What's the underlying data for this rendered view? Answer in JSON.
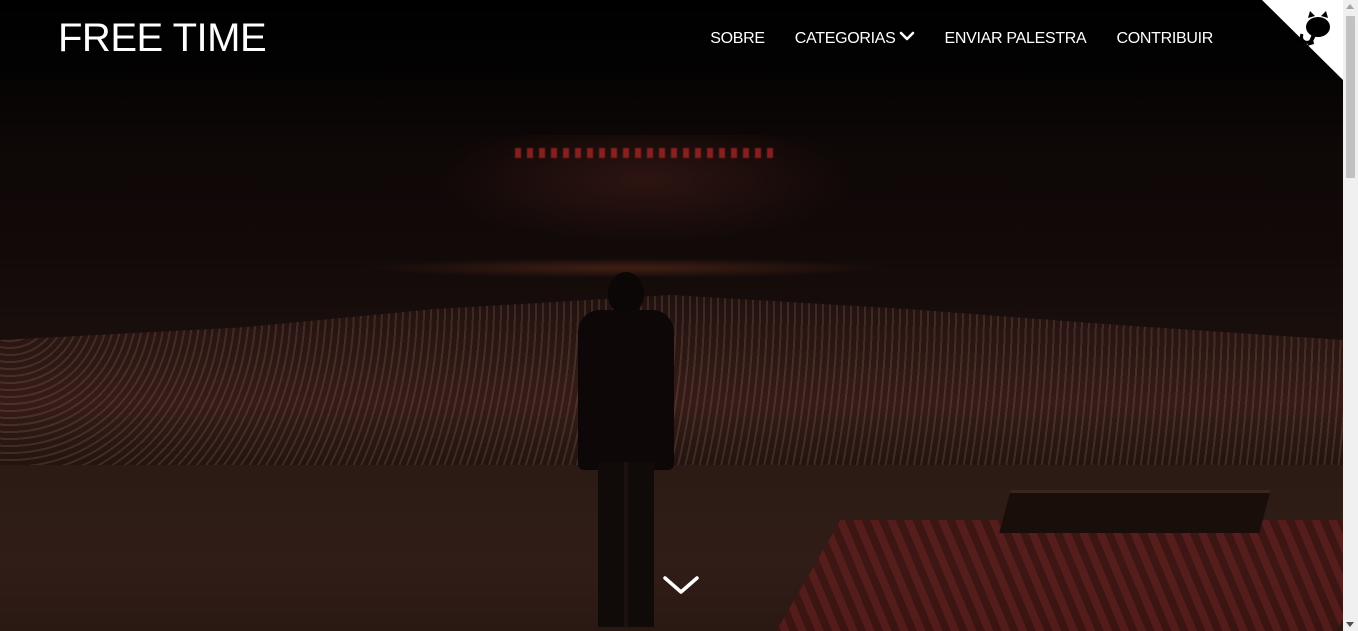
{
  "header": {
    "logo": "FREE TIME",
    "nav": [
      {
        "label": "SOBRE"
      },
      {
        "label": "CATEGORIAS",
        "icon": "chevron-down-icon"
      },
      {
        "label": "ENVIAR PALESTRA"
      },
      {
        "label": "CONTRIBUIR"
      }
    ]
  },
  "corner_ribbon": {
    "icon": "github-octocat-icon",
    "color": "#ffffff"
  },
  "hero": {
    "scroll_icon": "chevron-down-icon"
  },
  "colors": {
    "text": "#ffffff",
    "background": "#000000"
  }
}
